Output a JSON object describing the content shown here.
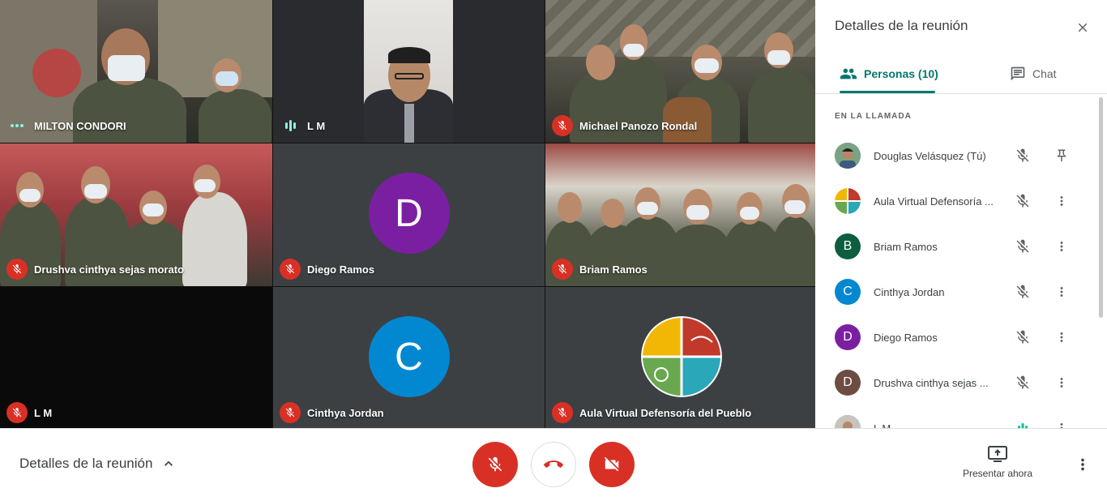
{
  "tiles": [
    {
      "name": "MILTON CONDORI",
      "status": "dots"
    },
    {
      "name": "L M",
      "status": "speaking"
    },
    {
      "name": "Michael Panozo Rondal",
      "status": "muted"
    },
    {
      "name": "Drushva cinthya sejas morato",
      "status": "muted"
    },
    {
      "name": "Diego Ramos",
      "status": "muted",
      "initial": "D",
      "color": "#7b1fa2"
    },
    {
      "name": "Briam Ramos",
      "status": "muted"
    },
    {
      "name": "L M",
      "status": "muted"
    },
    {
      "name": "Cinthya Jordan",
      "status": "muted",
      "initial": "C",
      "color": "#0288d1"
    },
    {
      "name": "Aula Virtual Defensoría del Pueblo",
      "status": "muted"
    }
  ],
  "panel": {
    "title": "Detalles de la reunión",
    "tab_people": "Personas (10)",
    "tab_chat": "Chat",
    "section_label": "EN LA LLAMADA",
    "participants": [
      {
        "name": "Douglas Velásquez (Tú)",
        "action": "pin-icon"
      },
      {
        "name": "Aula Virtual Defensoría ...",
        "action": "more-icon"
      },
      {
        "name": "Briam Ramos",
        "initial": "B",
        "color": "#0d5e3f",
        "action": "more-icon"
      },
      {
        "name": "Cinthya Jordan",
        "initial": "C",
        "color": "#0288d1",
        "action": "more-icon"
      },
      {
        "name": "Diego Ramos",
        "initial": "D",
        "color": "#7b1fa2",
        "action": "more-icon"
      },
      {
        "name": "Drushva cinthya sejas ...",
        "initial": "D",
        "color": "#6d4c41",
        "action": "more-icon"
      },
      {
        "name": "L M",
        "action": "more-icon"
      }
    ]
  },
  "bottom": {
    "details_label": "Detalles de la reunión",
    "present_label": "Presentar ahora"
  },
  "colors": {
    "accent": "#00796b",
    "danger": "#d93025",
    "speaking": "#8ef2e1"
  }
}
